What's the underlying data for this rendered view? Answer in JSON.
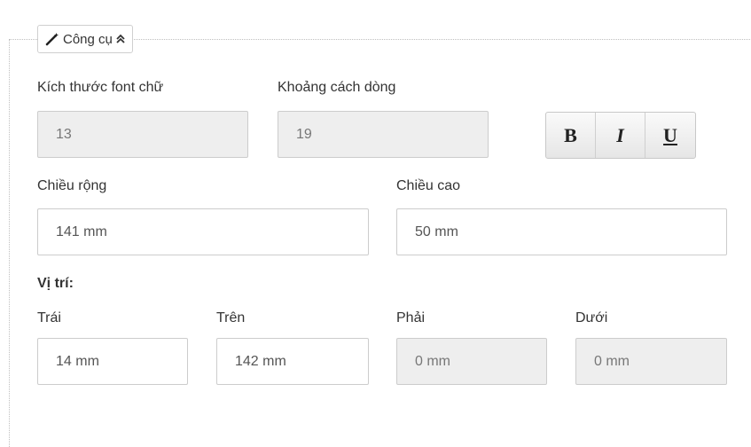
{
  "toolbox": {
    "title": "Công cụ",
    "icon": "magic-wand-icon",
    "toggle_icon": "chevron-double-up-icon"
  },
  "font": {
    "size_label": "Kích thước font chữ",
    "size_value": "13",
    "line_spacing_label": "Khoảng cách dòng",
    "line_spacing_value": "19"
  },
  "format_buttons": {
    "bold": "B",
    "italic": "I",
    "underline": "U"
  },
  "dimensions": {
    "width_label": "Chiều rộng",
    "width_value": "141 mm",
    "height_label": "Chiều cao",
    "height_value": "50 mm"
  },
  "position": {
    "heading": "Vị trí:",
    "left_label": "Trái",
    "left_value": "14 mm",
    "top_label": "Trên",
    "top_value": "142 mm",
    "right_label": "Phải",
    "right_value": "0 mm",
    "bottom_label": "Dưới",
    "bottom_value": "0 mm"
  }
}
